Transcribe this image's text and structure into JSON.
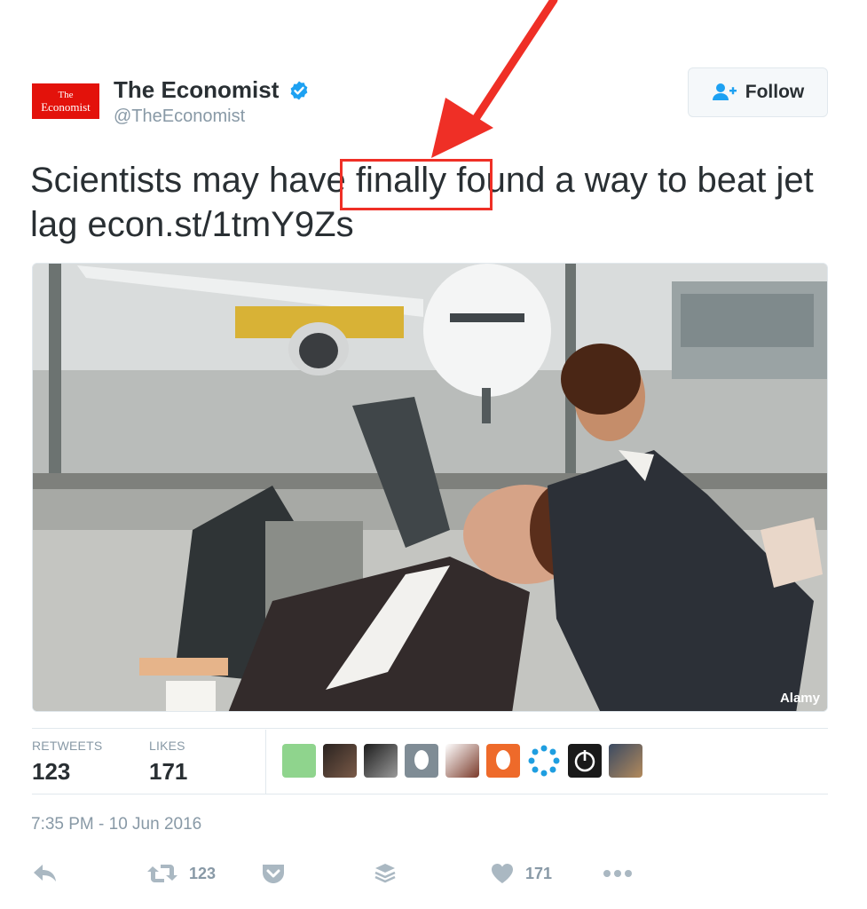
{
  "user": {
    "display_name": "The Economist",
    "handle": "@TheEconomist",
    "avatar_line1": "The",
    "avatar_line2": "Economist",
    "verified": true
  },
  "follow_button": {
    "label": "Follow",
    "icon": "add-user-icon"
  },
  "tweet": {
    "text_parts": {
      "before": "Scientists may have ",
      "highlight": "finally fo",
      "after": "und a way to beat jet lag econ.st/1tmY9Zs"
    }
  },
  "photo": {
    "credit": "Alamy"
  },
  "stats": {
    "retweets_label": "RETWEETS",
    "retweets_value": "123",
    "likes_label": "LIKES",
    "likes_value": "171"
  },
  "timestamp": "7:35 PM - 10 Jun 2016",
  "actions": {
    "reply_icon": "reply-icon",
    "retweet_icon": "retweet-icon",
    "retweet_count": "123",
    "pocket_icon": "pocket-icon",
    "buffer_icon": "buffer-icon",
    "like_icon": "heart-icon",
    "like_count": "171",
    "more_icon": "more-icon"
  },
  "colors": {
    "accent_red": "#ef2f26",
    "economist_red": "#e3120b",
    "verified_blue": "#1da1f2",
    "muted": "#8899a6",
    "icon_gray": "#aab8c2"
  }
}
